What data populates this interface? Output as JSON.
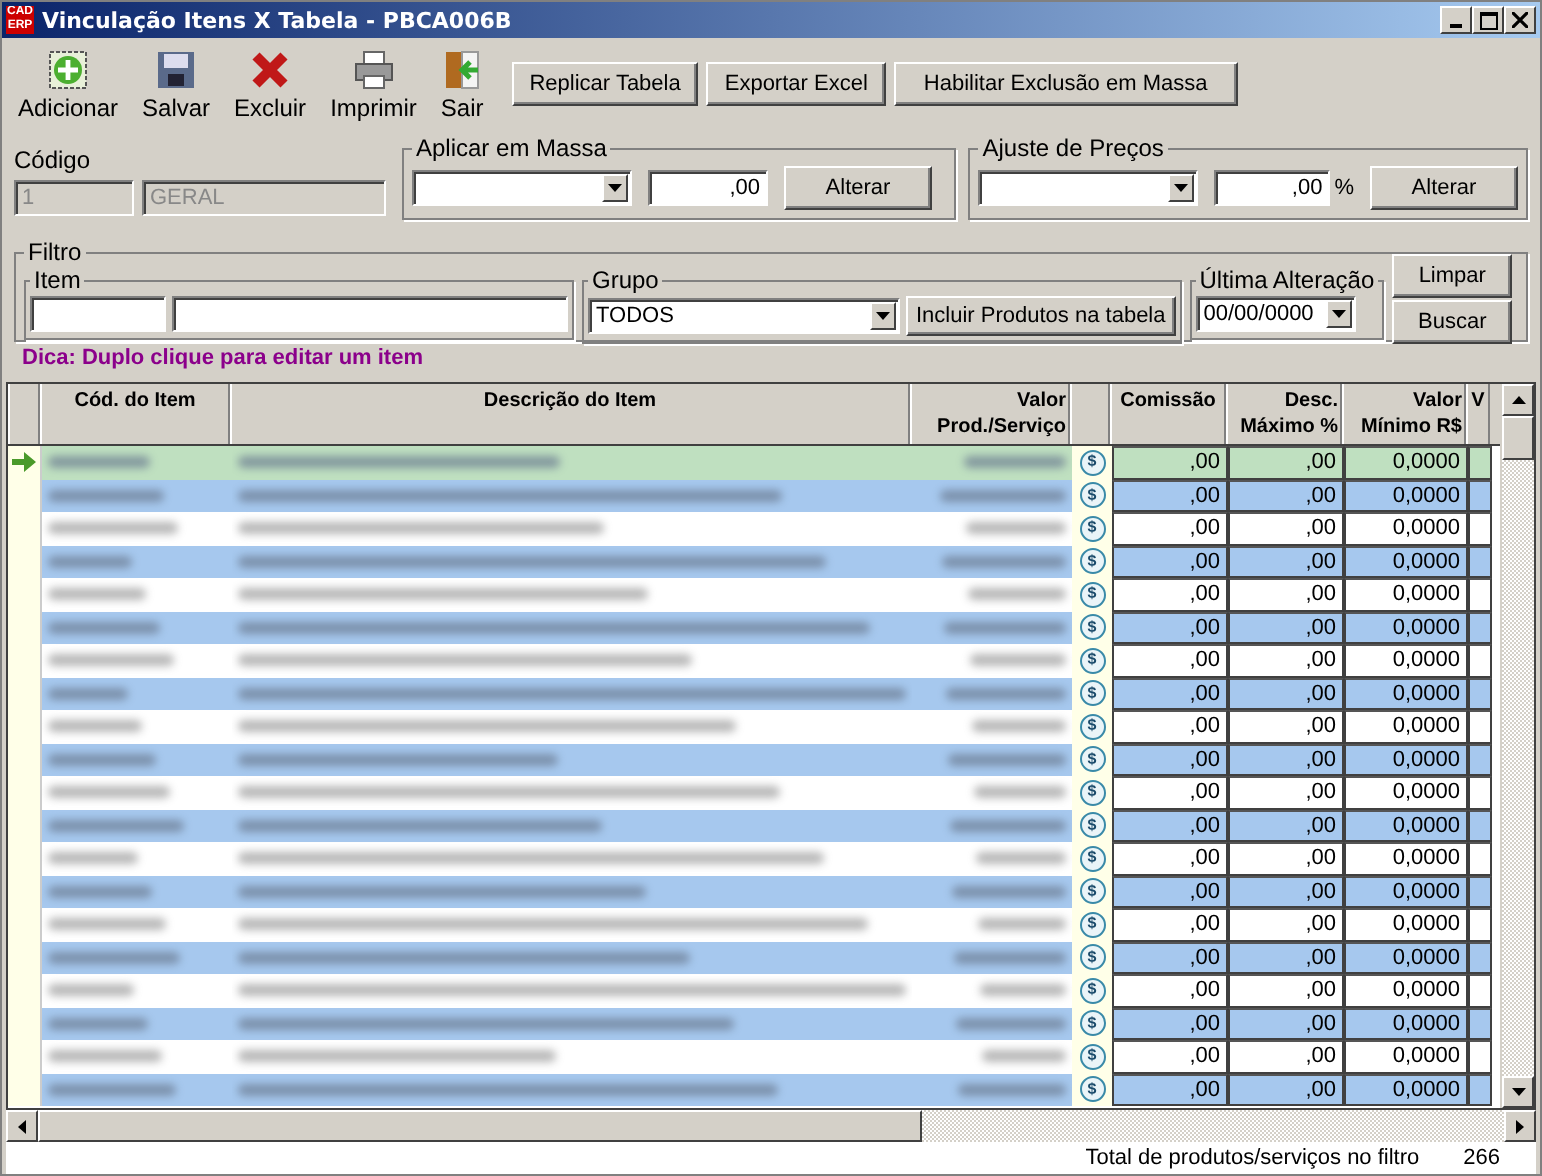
{
  "window": {
    "title": "Vinculação Itens X Tabela - PBCA006B",
    "app_badge": "CAD ERP"
  },
  "toolbar": [
    {
      "label": "Adicionar",
      "kind": "add"
    },
    {
      "label": "Salvar",
      "kind": "save"
    },
    {
      "label": "Excluir",
      "kind": "delete"
    },
    {
      "label": "Imprimir",
      "kind": "print"
    },
    {
      "label": "Sair",
      "kind": "exit"
    }
  ],
  "toolbar_buttons": [
    "Replicar Tabela",
    "Exportar Excel",
    "Habilitar Exclusão em Massa"
  ],
  "codigo": {
    "label": "Código",
    "code": "1",
    "name": "GERAL"
  },
  "aplicar_em_massa": {
    "title": "Aplicar em Massa",
    "value": ",00",
    "button": "Alterar"
  },
  "ajuste_de_precos": {
    "title": "Ajuste de Preços",
    "value": ",00",
    "unit": "%",
    "button": "Alterar"
  },
  "filtro": {
    "title": "Filtro",
    "item_label": "Item",
    "grupo_label": "Grupo",
    "grupo_value": "TODOS",
    "include_button": "Incluir Produtos na tabela",
    "ultima_label": "Última Alteração",
    "ultima_value": "00/00/0000",
    "clear_button": "Limpar",
    "search_button": "Buscar"
  },
  "hint": "Dica: Duplo clique para editar um item",
  "table": {
    "row_action": "$",
    "columns": [
      "Cód. do Item",
      "Descrição do Item",
      "Valor Prod./Serviço",
      "Comissão",
      "Desc. Máximo %",
      "Valor Mínimo R$",
      "V"
    ],
    "rows": [
      {
        "selected": true,
        "comissao": ",00",
        "desc_maximo": ",00",
        "valor_minimo": "0,0000"
      },
      {
        "selected": false,
        "comissao": ",00",
        "desc_maximo": ",00",
        "valor_minimo": "0,0000"
      },
      {
        "selected": false,
        "comissao": ",00",
        "desc_maximo": ",00",
        "valor_minimo": "0,0000"
      },
      {
        "selected": false,
        "comissao": ",00",
        "desc_maximo": ",00",
        "valor_minimo": "0,0000"
      },
      {
        "selected": false,
        "comissao": ",00",
        "desc_maximo": ",00",
        "valor_minimo": "0,0000"
      },
      {
        "selected": false,
        "comissao": ",00",
        "desc_maximo": ",00",
        "valor_minimo": "0,0000"
      },
      {
        "selected": false,
        "comissao": ",00",
        "desc_maximo": ",00",
        "valor_minimo": "0,0000"
      },
      {
        "selected": false,
        "comissao": ",00",
        "desc_maximo": ",00",
        "valor_minimo": "0,0000"
      },
      {
        "selected": false,
        "comissao": ",00",
        "desc_maximo": ",00",
        "valor_minimo": "0,0000"
      },
      {
        "selected": false,
        "comissao": ",00",
        "desc_maximo": ",00",
        "valor_minimo": "0,0000"
      },
      {
        "selected": false,
        "comissao": ",00",
        "desc_maximo": ",00",
        "valor_minimo": "0,0000"
      },
      {
        "selected": false,
        "comissao": ",00",
        "desc_maximo": ",00",
        "valor_minimo": "0,0000"
      },
      {
        "selected": false,
        "comissao": ",00",
        "desc_maximo": ",00",
        "valor_minimo": "0,0000"
      },
      {
        "selected": false,
        "comissao": ",00",
        "desc_maximo": ",00",
        "valor_minimo": "0,0000"
      },
      {
        "selected": false,
        "comissao": ",00",
        "desc_maximo": ",00",
        "valor_minimo": "0,0000"
      },
      {
        "selected": false,
        "comissao": ",00",
        "desc_maximo": ",00",
        "valor_minimo": "0,0000"
      },
      {
        "selected": false,
        "comissao": ",00",
        "desc_maximo": ",00",
        "valor_minimo": "0,0000"
      },
      {
        "selected": false,
        "comissao": ",00",
        "desc_maximo": ",00",
        "valor_minimo": "0,0000"
      },
      {
        "selected": false,
        "comissao": ",00",
        "desc_maximo": ",00",
        "valor_minimo": "0,0000"
      },
      {
        "selected": false,
        "comissao": ",00",
        "desc_maximo": ",00",
        "valor_minimo": "0,0000"
      }
    ]
  },
  "status_bar": {
    "label": "Total de produtos/serviços no filtro",
    "count": "266"
  }
}
